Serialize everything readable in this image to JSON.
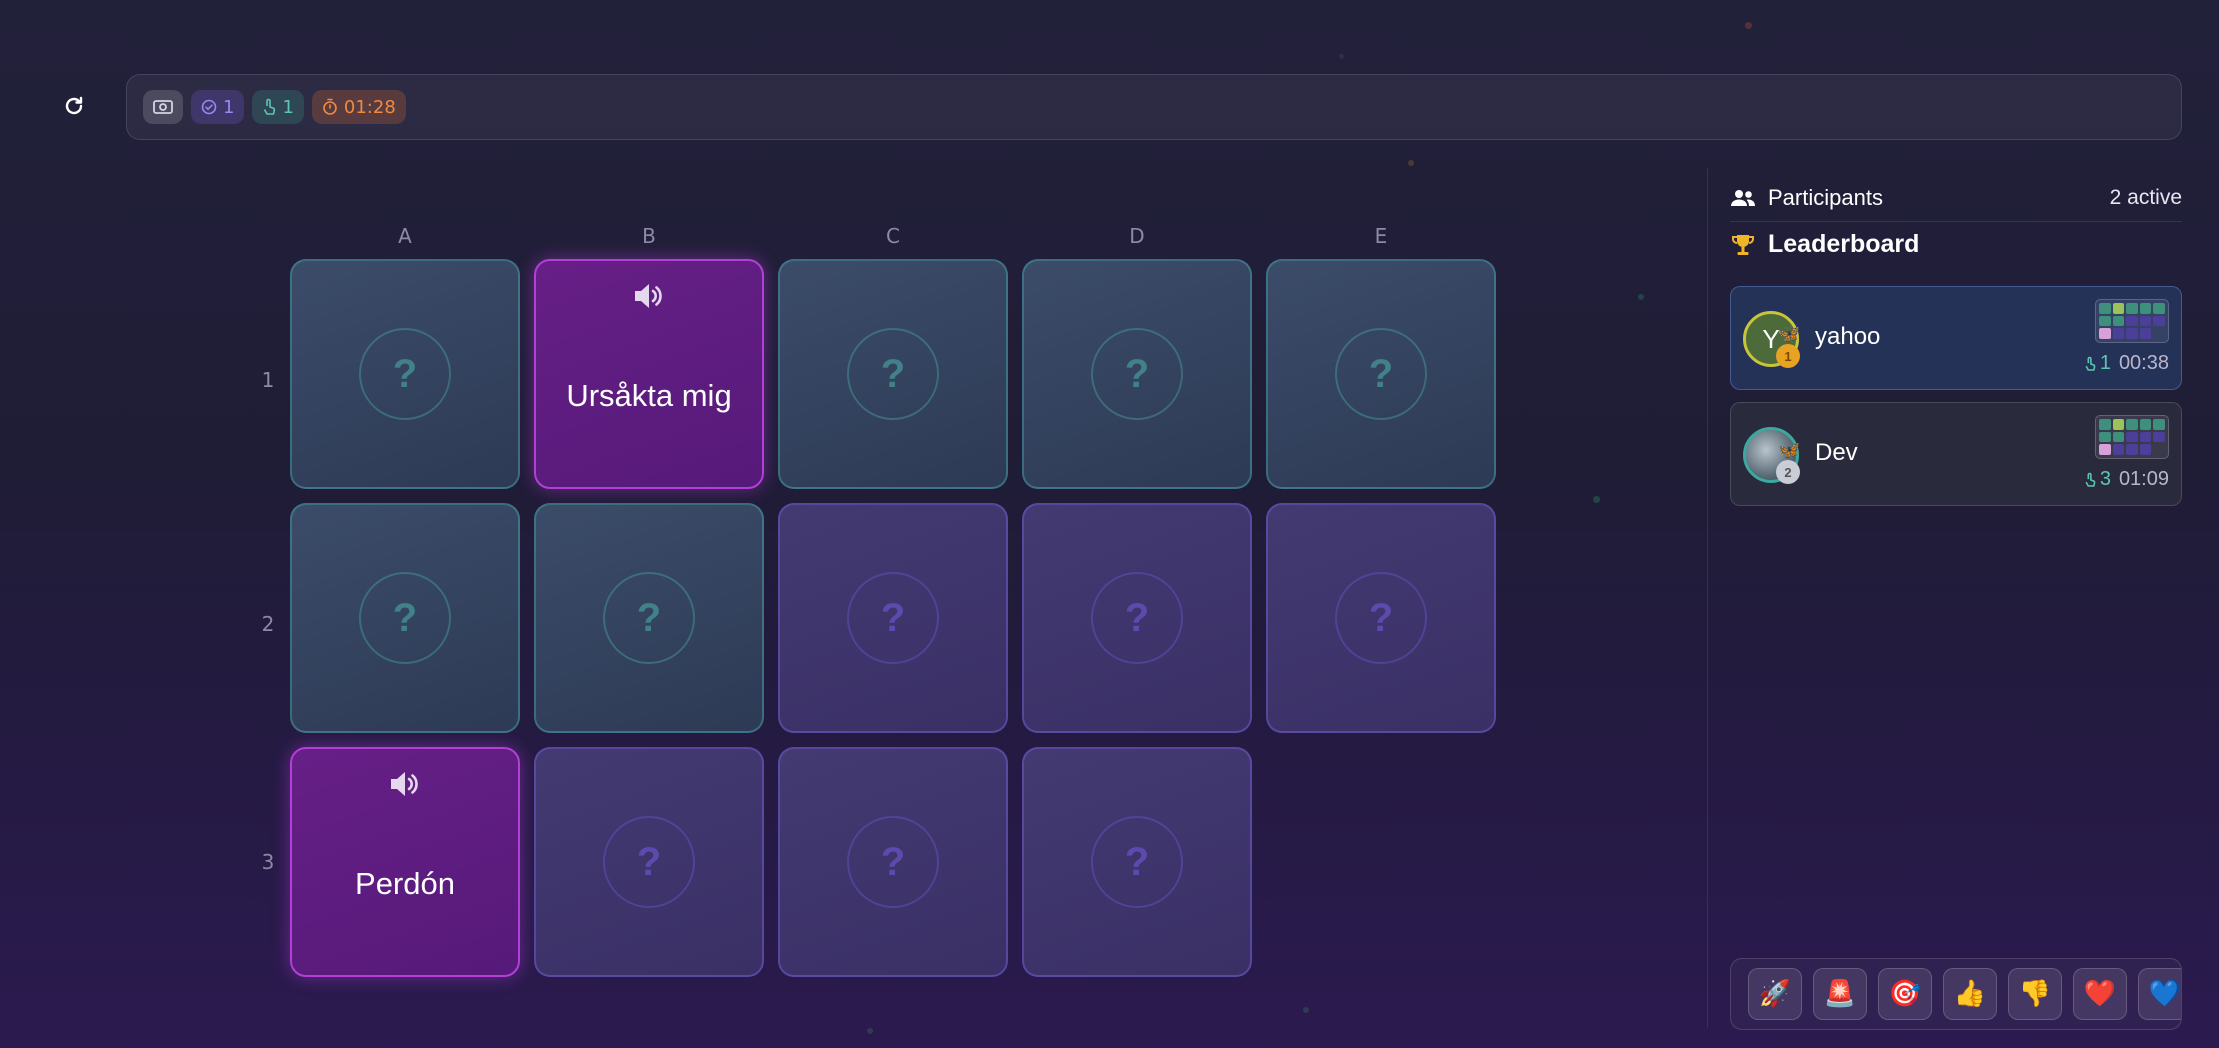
{
  "toolbar": {
    "correct_count": "1",
    "attempts_count": "1",
    "timer": "01:28"
  },
  "grid": {
    "columns": [
      "A",
      "B",
      "C",
      "D",
      "E"
    ],
    "rows": [
      "1",
      "2",
      "3"
    ],
    "cards": {
      "b1_word": "Ursåkta mig",
      "a3_word": "Perdón",
      "hidden_symbol": "?"
    }
  },
  "panel": {
    "participants_title": "Participants",
    "active_count": "2 active",
    "leaderboard_title": "Leaderboard",
    "entries": [
      {
        "initial": "Y",
        "name": "yahoo",
        "attempts": "1",
        "time": "00:38",
        "medal": "1"
      },
      {
        "initial": "",
        "name": "Dev",
        "attempts": "3",
        "time": "01:09",
        "medal": "2"
      }
    ]
  },
  "reactions": [
    "🚀",
    "🚨",
    "🎯",
    "👍",
    "👎",
    "❤️",
    "💙"
  ],
  "colors": {
    "accent_purple": "#b23fd6",
    "teal": "#5cc7b0",
    "orange": "#f08a3e",
    "violet": "#9a86f5"
  }
}
